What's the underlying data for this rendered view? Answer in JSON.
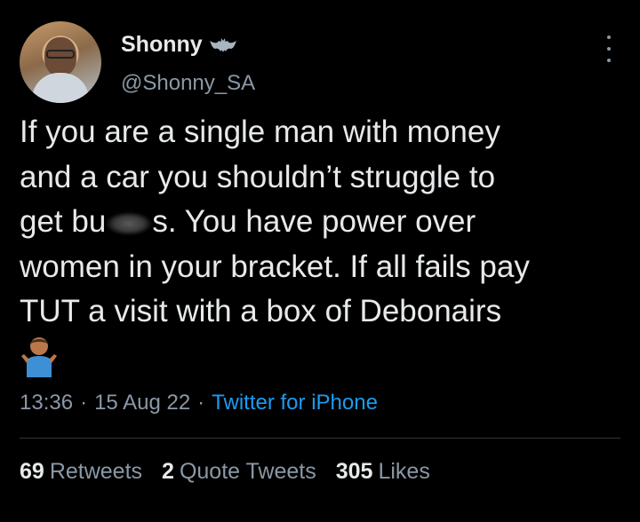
{
  "author": {
    "name": "Shonny",
    "handle": "@Shonny_SA"
  },
  "tweet": {
    "lines": [
      "If you are a single man with money",
      "and a car you shouldn’t struggle to",
      "get bu",
      "s. You have power over",
      "women in your bracket. If all fails pay",
      "TUT a visit with a box of Debonairs"
    ],
    "emoji": "person-shrugging"
  },
  "meta": {
    "time": "13:36",
    "sep1": "·",
    "date": "15 Aug 22",
    "sep2": "·",
    "source": "Twitter for iPhone"
  },
  "stats": {
    "retweets_count": "69",
    "retweets_label": "Retweets",
    "quotes_count": "2",
    "quotes_label": "Quote Tweets",
    "likes_count": "305",
    "likes_label": "Likes"
  },
  "colors": {
    "background": "#000000",
    "text": "#e7e9ea",
    "muted": "#8b98a5",
    "link": "#1d9bf0"
  },
  "icons": [
    "avatar",
    "bat-icon",
    "more-icon",
    "shrug-emoji-icon"
  ]
}
